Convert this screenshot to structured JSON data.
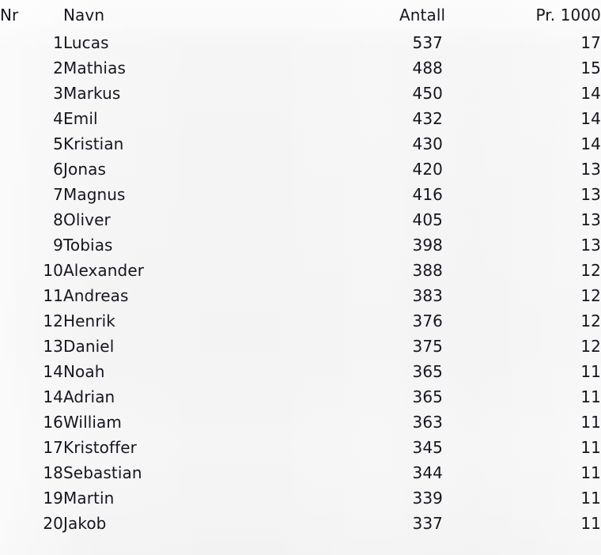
{
  "table": {
    "columns": [
      {
        "key": "nr",
        "label": "Nr",
        "align": "left"
      },
      {
        "key": "navn",
        "label": "Navn",
        "align": "left"
      },
      {
        "key": "antall",
        "label": "Antall",
        "align": "right"
      },
      {
        "key": "pr1000",
        "label": "Pr. 1000",
        "align": "right"
      }
    ],
    "rows": [
      {
        "nr": "1",
        "navn": "Lucas",
        "antall": "537",
        "pr1000": "17"
      },
      {
        "nr": "2",
        "navn": "Mathias",
        "antall": "488",
        "pr1000": "15"
      },
      {
        "nr": "3",
        "navn": "Markus",
        "antall": "450",
        "pr1000": "14"
      },
      {
        "nr": "4",
        "navn": "Emil",
        "antall": "432",
        "pr1000": "14"
      },
      {
        "nr": "5",
        "navn": "Kristian",
        "antall": "430",
        "pr1000": "14"
      },
      {
        "nr": "6",
        "navn": "Jonas",
        "antall": "420",
        "pr1000": "13"
      },
      {
        "nr": "7",
        "navn": "Magnus",
        "antall": "416",
        "pr1000": "13"
      },
      {
        "nr": "8",
        "navn": "Oliver",
        "antall": "405",
        "pr1000": "13"
      },
      {
        "nr": "9",
        "navn": "Tobias",
        "antall": "398",
        "pr1000": "13"
      },
      {
        "nr": "10",
        "navn": "Alexander",
        "antall": "388",
        "pr1000": "12"
      },
      {
        "nr": "11",
        "navn": "Andreas",
        "antall": "383",
        "pr1000": "12"
      },
      {
        "nr": "12",
        "navn": "Henrik",
        "antall": "376",
        "pr1000": "12"
      },
      {
        "nr": "13",
        "navn": "Daniel",
        "antall": "375",
        "pr1000": "12"
      },
      {
        "nr": "14",
        "navn": "Noah",
        "antall": "365",
        "pr1000": "11"
      },
      {
        "nr": "14",
        "navn": "Adrian",
        "antall": "365",
        "pr1000": "11"
      },
      {
        "nr": "16",
        "navn": "William",
        "antall": "363",
        "pr1000": "11"
      },
      {
        "nr": "17",
        "navn": "Kristoffer",
        "antall": "345",
        "pr1000": "11"
      },
      {
        "nr": "18",
        "navn": "Sebastian",
        "antall": "344",
        "pr1000": "11"
      },
      {
        "nr": "19",
        "navn": "Martin",
        "antall": "339",
        "pr1000": "11"
      },
      {
        "nr": "20",
        "navn": "Jakob",
        "antall": "337",
        "pr1000": "11"
      }
    ]
  },
  "colors": {
    "text": "#16161f",
    "background": "#f4f4f4"
  }
}
